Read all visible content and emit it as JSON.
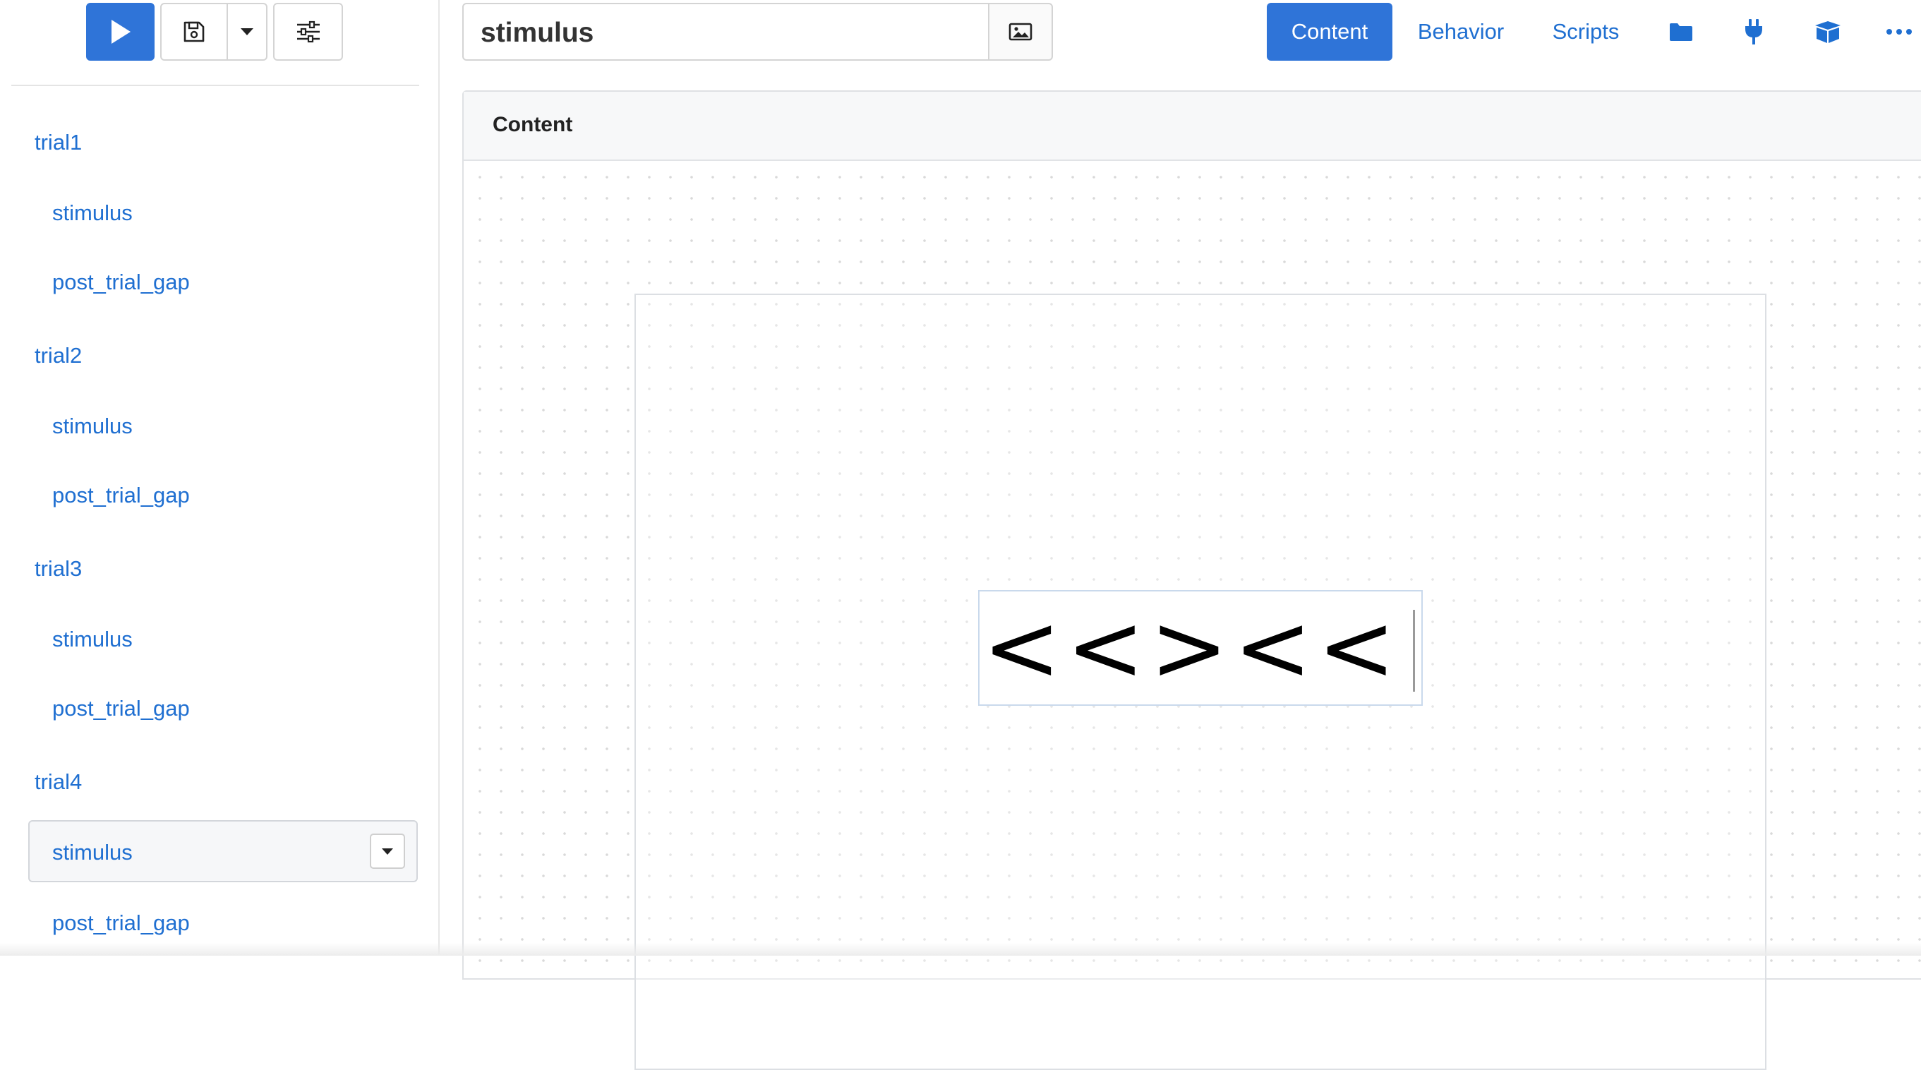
{
  "toolbar": {
    "run_icon": "play-icon",
    "save_icon": "save-icon",
    "save_dropdown_icon": "caret-down-icon",
    "settings_icon": "sliders-icon"
  },
  "sidebar": {
    "items": [
      {
        "label": "trial1",
        "level": 0
      },
      {
        "label": "stimulus",
        "level": 1
      },
      {
        "label": "post_trial_gap",
        "level": 1
      },
      {
        "label": "trial2",
        "level": 0
      },
      {
        "label": "stimulus",
        "level": 1
      },
      {
        "label": "post_trial_gap",
        "level": 1
      },
      {
        "label": "trial3",
        "level": 0
      },
      {
        "label": "stimulus",
        "level": 1
      },
      {
        "label": "post_trial_gap",
        "level": 1
      },
      {
        "label": "trial4",
        "level": 0
      },
      {
        "label": "stimulus",
        "level": 1,
        "selected": true
      },
      {
        "label": "post_trial_gap",
        "level": 1
      }
    ]
  },
  "header": {
    "component_name": "stimulus",
    "media_icon": "image-icon",
    "tabs": {
      "content": "Content",
      "behavior": "Behavior",
      "scripts": "Scripts"
    },
    "icons": [
      "folder-icon",
      "plug-icon",
      "box-icon",
      "more-icon"
    ]
  },
  "content_panel": {
    "title": "Content",
    "stimulus_text": "<<><<"
  },
  "colors": {
    "accent": "#2f74d8",
    "link": "#1f6fd1"
  }
}
